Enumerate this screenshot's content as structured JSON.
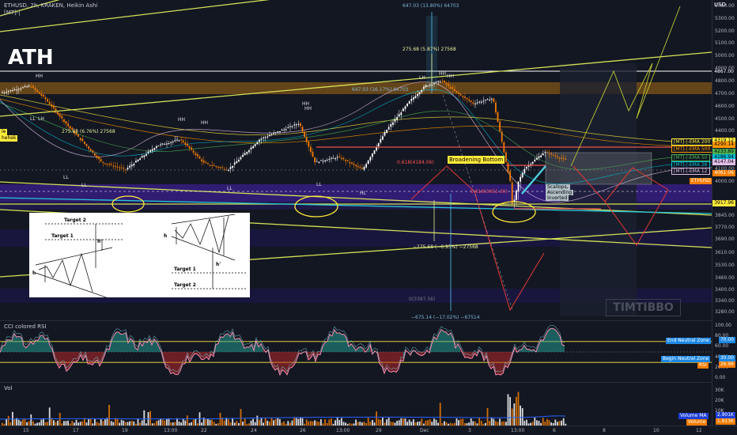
{
  "header": {
    "symbol_line": "ETHUSD, 2h, KRAKEN, Heikin Ashi",
    "indicator_tag": "[MT]-|",
    "ath_label": "ATH",
    "watermark": "TIMTIBBO"
  },
  "price_axis": {
    "currency": "USD",
    "ticks": [
      "5400.00",
      "5300.00",
      "5200.00",
      "5100.00",
      "5000.00",
      "4900.00",
      "4800.00",
      "4700.00",
      "4600.00",
      "4500.00",
      "4400.00",
      "4300.00",
      "4200.00",
      "4100.00",
      "4000.00",
      "3920.00",
      "3845.00",
      "3770.00",
      "3690.00",
      "3610.00",
      "3530.00",
      "3460.00",
      "3400.00",
      "3340.00",
      "3280.00"
    ],
    "labels": [
      {
        "text": "4867.00",
        "bg": "#131722",
        "fg": "#ffffff",
        "value": 4867
      },
      {
        "text": "4319.12",
        "bg": "#ffeb3b",
        "fg": "#000000",
        "value": 4319
      },
      {
        "text": "4290.14",
        "bg": "#ff9800",
        "fg": "#000000",
        "value": 4290
      },
      {
        "text": "4233.89",
        "bg": "#4caf50",
        "fg": "#000000",
        "value": 4234
      },
      {
        "text": "4186.94",
        "bg": "#00bcd4",
        "fg": "#000000",
        "value": 4187
      },
      {
        "text": "4147.04",
        "bg": "#e1bee7",
        "fg": "#000000",
        "value": 4147
      },
      {
        "text": "4061.06",
        "bg": "#f57c00",
        "fg": "#ffffff",
        "value": 4061
      },
      {
        "text": "3917.96",
        "bg": "#ffeb3b",
        "fg": "#000000",
        "value": 3918
      }
    ]
  },
  "ema_legend": [
    {
      "text": "[MT]-|-EMA 200",
      "color": "#ffeb3b"
    },
    {
      "text": "[MT]-|-EMA 500",
      "color": "#ff9800"
    },
    {
      "text": "[MT]-|-EMA 50",
      "color": "#4caf50"
    },
    {
      "text": "[MT]-|-EMA 26",
      "color": "#00bcd4"
    },
    {
      "text": "[MT]-|-EMA 12",
      "color": "#e1bee7"
    }
  ],
  "symbol_tag": "ETHUSD",
  "annotations": {
    "measure_top": "647.03 (13.80%) 64703",
    "measure_mid": "275.68 (5.87%) 27568",
    "measure_hh": "647.03 (16.17%) 64703",
    "measure_left": "275.68 (6.76%) 27568",
    "measure_down": "−275.68 (−6.95%) −27568",
    "measure_bottom": "−675.14 (−17.02%) −67514",
    "broadening": "Broadening Bottom",
    "scallops_1": "Scallops,",
    "scallops_2": "Ascending",
    "scallops_3": "Inverted",
    "fib_1": "0.618(4184.06)",
    "fib_2": "0.618(3952.30)",
    "fib_3": "0(3397.56)",
    "left_tag_1": "le",
    "left_tag_2": "hehek"
  },
  "swing_labels": [
    "HH",
    "LL",
    "LH",
    "HH",
    "LL",
    "HH",
    "HH",
    "LH",
    "LL",
    "HH",
    "HH",
    "LL",
    "LL",
    "HL",
    "HH"
  ],
  "pattern_diagram": {
    "left_target2": "Target 2",
    "left_target1": "Target 1",
    "right_target1": "Target 1",
    "right_target2": "Target 2",
    "h": "h",
    "h_prime": "h'"
  },
  "cci_pane": {
    "title": "CCI colored RSI",
    "ticks": [
      "100.00",
      "80.00",
      "60.00",
      "40.00",
      "20.00",
      "0.00"
    ],
    "end_zone": "End Neutral Zone",
    "end_zone_value": "70.00",
    "begin_zone": "Begin Neutral Zone",
    "begin_zone_value": "30.00",
    "rsi_label": "RSI",
    "rsi_value": "26.96"
  },
  "vol_pane": {
    "title": "Vol",
    "ticks": [
      "30K",
      "20K",
      "10K"
    ],
    "volume_ma": "Volume MA",
    "volume_ma_value": "2.901K",
    "volume_label": "Volume",
    "volume_value": "1.913K"
  },
  "time_axis": [
    "15",
    "17",
    "19",
    "13:00",
    "22",
    "24",
    "26",
    "13:00",
    "29",
    "Dec",
    "3",
    "13:00",
    "6",
    "8",
    "10",
    "12"
  ]
}
